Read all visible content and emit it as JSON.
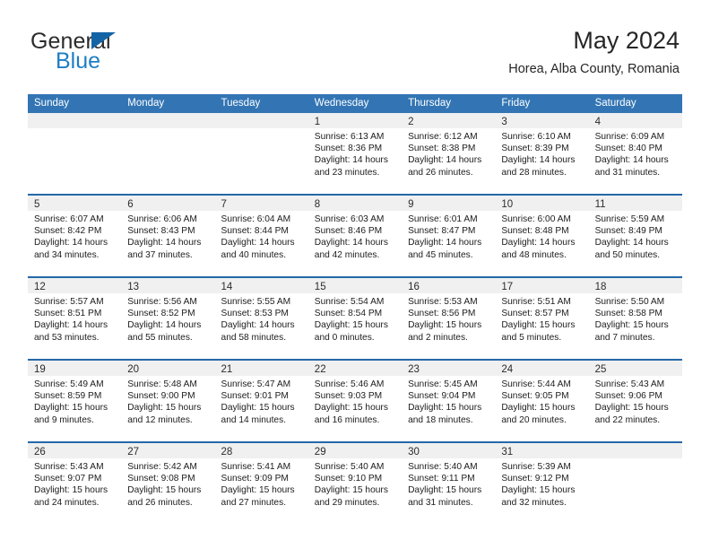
{
  "brand": {
    "name_part1": "General",
    "name_part2": "Blue",
    "icon": "triangle-logo",
    "accent_color": "#1d7ec4",
    "triangle_color": "#1464a5"
  },
  "header": {
    "month_title": "May 2024",
    "location": "Horea, Alba County, Romania"
  },
  "colors": {
    "header_band": "#3375b4",
    "row_separator": "#2469a8",
    "day_number_band": "#f0f0f0"
  },
  "calendar": {
    "weekdays": [
      "Sunday",
      "Monday",
      "Tuesday",
      "Wednesday",
      "Thursday",
      "Friday",
      "Saturday"
    ],
    "weeks": [
      [
        {
          "day": "",
          "empty": true,
          "sunrise": "",
          "sunset": "",
          "daylight_line1": "",
          "daylight_line2": ""
        },
        {
          "day": "",
          "empty": true,
          "sunrise": "",
          "sunset": "",
          "daylight_line1": "",
          "daylight_line2": ""
        },
        {
          "day": "",
          "empty": true,
          "sunrise": "",
          "sunset": "",
          "daylight_line1": "",
          "daylight_line2": ""
        },
        {
          "day": "1",
          "empty": false,
          "sunrise": "Sunrise: 6:13 AM",
          "sunset": "Sunset: 8:36 PM",
          "daylight_line1": "Daylight: 14 hours",
          "daylight_line2": "and 23 minutes."
        },
        {
          "day": "2",
          "empty": false,
          "sunrise": "Sunrise: 6:12 AM",
          "sunset": "Sunset: 8:38 PM",
          "daylight_line1": "Daylight: 14 hours",
          "daylight_line2": "and 26 minutes."
        },
        {
          "day": "3",
          "empty": false,
          "sunrise": "Sunrise: 6:10 AM",
          "sunset": "Sunset: 8:39 PM",
          "daylight_line1": "Daylight: 14 hours",
          "daylight_line2": "and 28 minutes."
        },
        {
          "day": "4",
          "empty": false,
          "sunrise": "Sunrise: 6:09 AM",
          "sunset": "Sunset: 8:40 PM",
          "daylight_line1": "Daylight: 14 hours",
          "daylight_line2": "and 31 minutes."
        }
      ],
      [
        {
          "day": "5",
          "empty": false,
          "sunrise": "Sunrise: 6:07 AM",
          "sunset": "Sunset: 8:42 PM",
          "daylight_line1": "Daylight: 14 hours",
          "daylight_line2": "and 34 minutes."
        },
        {
          "day": "6",
          "empty": false,
          "sunrise": "Sunrise: 6:06 AM",
          "sunset": "Sunset: 8:43 PM",
          "daylight_line1": "Daylight: 14 hours",
          "daylight_line2": "and 37 minutes."
        },
        {
          "day": "7",
          "empty": false,
          "sunrise": "Sunrise: 6:04 AM",
          "sunset": "Sunset: 8:44 PM",
          "daylight_line1": "Daylight: 14 hours",
          "daylight_line2": "and 40 minutes."
        },
        {
          "day": "8",
          "empty": false,
          "sunrise": "Sunrise: 6:03 AM",
          "sunset": "Sunset: 8:46 PM",
          "daylight_line1": "Daylight: 14 hours",
          "daylight_line2": "and 42 minutes."
        },
        {
          "day": "9",
          "empty": false,
          "sunrise": "Sunrise: 6:01 AM",
          "sunset": "Sunset: 8:47 PM",
          "daylight_line1": "Daylight: 14 hours",
          "daylight_line2": "and 45 minutes."
        },
        {
          "day": "10",
          "empty": false,
          "sunrise": "Sunrise: 6:00 AM",
          "sunset": "Sunset: 8:48 PM",
          "daylight_line1": "Daylight: 14 hours",
          "daylight_line2": "and 48 minutes."
        },
        {
          "day": "11",
          "empty": false,
          "sunrise": "Sunrise: 5:59 AM",
          "sunset": "Sunset: 8:49 PM",
          "daylight_line1": "Daylight: 14 hours",
          "daylight_line2": "and 50 minutes."
        }
      ],
      [
        {
          "day": "12",
          "empty": false,
          "sunrise": "Sunrise: 5:57 AM",
          "sunset": "Sunset: 8:51 PM",
          "daylight_line1": "Daylight: 14 hours",
          "daylight_line2": "and 53 minutes."
        },
        {
          "day": "13",
          "empty": false,
          "sunrise": "Sunrise: 5:56 AM",
          "sunset": "Sunset: 8:52 PM",
          "daylight_line1": "Daylight: 14 hours",
          "daylight_line2": "and 55 minutes."
        },
        {
          "day": "14",
          "empty": false,
          "sunrise": "Sunrise: 5:55 AM",
          "sunset": "Sunset: 8:53 PM",
          "daylight_line1": "Daylight: 14 hours",
          "daylight_line2": "and 58 minutes."
        },
        {
          "day": "15",
          "empty": false,
          "sunrise": "Sunrise: 5:54 AM",
          "sunset": "Sunset: 8:54 PM",
          "daylight_line1": "Daylight: 15 hours",
          "daylight_line2": "and 0 minutes."
        },
        {
          "day": "16",
          "empty": false,
          "sunrise": "Sunrise: 5:53 AM",
          "sunset": "Sunset: 8:56 PM",
          "daylight_line1": "Daylight: 15 hours",
          "daylight_line2": "and 2 minutes."
        },
        {
          "day": "17",
          "empty": false,
          "sunrise": "Sunrise: 5:51 AM",
          "sunset": "Sunset: 8:57 PM",
          "daylight_line1": "Daylight: 15 hours",
          "daylight_line2": "and 5 minutes."
        },
        {
          "day": "18",
          "empty": false,
          "sunrise": "Sunrise: 5:50 AM",
          "sunset": "Sunset: 8:58 PM",
          "daylight_line1": "Daylight: 15 hours",
          "daylight_line2": "and 7 minutes."
        }
      ],
      [
        {
          "day": "19",
          "empty": false,
          "sunrise": "Sunrise: 5:49 AM",
          "sunset": "Sunset: 8:59 PM",
          "daylight_line1": "Daylight: 15 hours",
          "daylight_line2": "and 9 minutes."
        },
        {
          "day": "20",
          "empty": false,
          "sunrise": "Sunrise: 5:48 AM",
          "sunset": "Sunset: 9:00 PM",
          "daylight_line1": "Daylight: 15 hours",
          "daylight_line2": "and 12 minutes."
        },
        {
          "day": "21",
          "empty": false,
          "sunrise": "Sunrise: 5:47 AM",
          "sunset": "Sunset: 9:01 PM",
          "daylight_line1": "Daylight: 15 hours",
          "daylight_line2": "and 14 minutes."
        },
        {
          "day": "22",
          "empty": false,
          "sunrise": "Sunrise: 5:46 AM",
          "sunset": "Sunset: 9:03 PM",
          "daylight_line1": "Daylight: 15 hours",
          "daylight_line2": "and 16 minutes."
        },
        {
          "day": "23",
          "empty": false,
          "sunrise": "Sunrise: 5:45 AM",
          "sunset": "Sunset: 9:04 PM",
          "daylight_line1": "Daylight: 15 hours",
          "daylight_line2": "and 18 minutes."
        },
        {
          "day": "24",
          "empty": false,
          "sunrise": "Sunrise: 5:44 AM",
          "sunset": "Sunset: 9:05 PM",
          "daylight_line1": "Daylight: 15 hours",
          "daylight_line2": "and 20 minutes."
        },
        {
          "day": "25",
          "empty": false,
          "sunrise": "Sunrise: 5:43 AM",
          "sunset": "Sunset: 9:06 PM",
          "daylight_line1": "Daylight: 15 hours",
          "daylight_line2": "and 22 minutes."
        }
      ],
      [
        {
          "day": "26",
          "empty": false,
          "sunrise": "Sunrise: 5:43 AM",
          "sunset": "Sunset: 9:07 PM",
          "daylight_line1": "Daylight: 15 hours",
          "daylight_line2": "and 24 minutes."
        },
        {
          "day": "27",
          "empty": false,
          "sunrise": "Sunrise: 5:42 AM",
          "sunset": "Sunset: 9:08 PM",
          "daylight_line1": "Daylight: 15 hours",
          "daylight_line2": "and 26 minutes."
        },
        {
          "day": "28",
          "empty": false,
          "sunrise": "Sunrise: 5:41 AM",
          "sunset": "Sunset: 9:09 PM",
          "daylight_line1": "Daylight: 15 hours",
          "daylight_line2": "and 27 minutes."
        },
        {
          "day": "29",
          "empty": false,
          "sunrise": "Sunrise: 5:40 AM",
          "sunset": "Sunset: 9:10 PM",
          "daylight_line1": "Daylight: 15 hours",
          "daylight_line2": "and 29 minutes."
        },
        {
          "day": "30",
          "empty": false,
          "sunrise": "Sunrise: 5:40 AM",
          "sunset": "Sunset: 9:11 PM",
          "daylight_line1": "Daylight: 15 hours",
          "daylight_line2": "and 31 minutes."
        },
        {
          "day": "31",
          "empty": false,
          "sunrise": "Sunrise: 5:39 AM",
          "sunset": "Sunset: 9:12 PM",
          "daylight_line1": "Daylight: 15 hours",
          "daylight_line2": "and 32 minutes."
        },
        {
          "day": "",
          "empty": true,
          "sunrise": "",
          "sunset": "",
          "daylight_line1": "",
          "daylight_line2": ""
        }
      ]
    ]
  }
}
